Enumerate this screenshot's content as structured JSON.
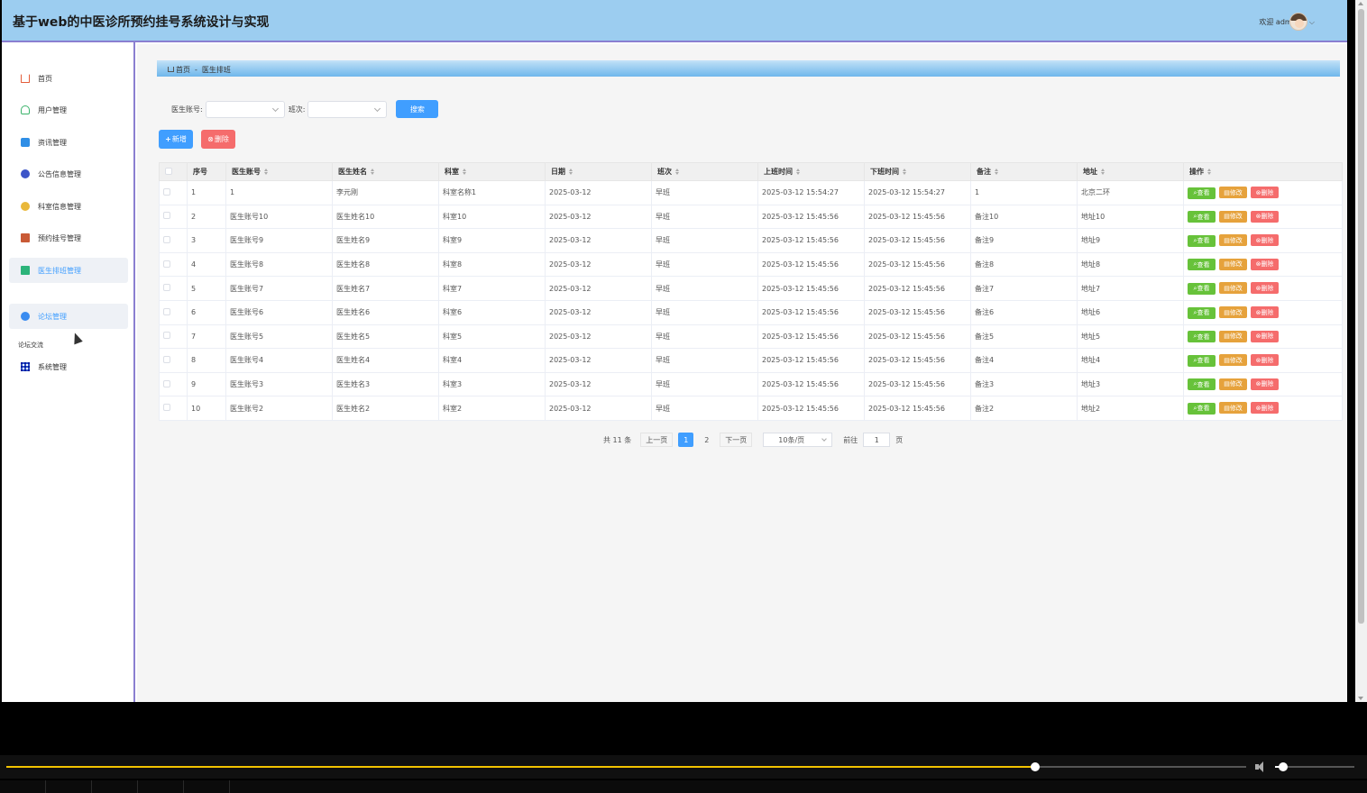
{
  "header": {
    "title": "基于web的中医诊所预约挂号系统设计与实现",
    "welcome": "欢迎 admin",
    "avatar_icon": "avatar-icon",
    "caret": "⌵"
  },
  "sidebar": {
    "items": [
      {
        "label": "首页",
        "icon": "home-icon"
      },
      {
        "label": "用户管理",
        "icon": "user-icon"
      },
      {
        "label": "资讯管理",
        "icon": "news-icon"
      },
      {
        "label": "公告信息管理",
        "icon": "notice-icon"
      },
      {
        "label": "科室信息管理",
        "icon": "department-icon"
      },
      {
        "label": "预约挂号管理",
        "icon": "appointment-icon"
      },
      {
        "label": "医生排班管理",
        "icon": "schedule-icon",
        "active": true
      },
      {
        "label": "论坛管理",
        "icon": "forum-icon"
      },
      {
        "label": "系统管理",
        "icon": "grid-icon"
      }
    ],
    "forum_note": "论坛交流"
  },
  "breadcrumb": {
    "home": "首页",
    "separator": "-",
    "current": "医生排班"
  },
  "search": {
    "account_label": "医生账号:",
    "shift_label": "班次:",
    "search_button": "搜索"
  },
  "actions": {
    "add": "新增",
    "delete": "删除"
  },
  "table": {
    "headers": [
      "序号",
      "医生账号",
      "医生姓名",
      "科室",
      "日期",
      "班次",
      "上班时间",
      "下班时间",
      "备注",
      "地址",
      "操作"
    ],
    "op_view": "查看",
    "op_edit": "修改",
    "op_delete": "删除",
    "rows": [
      [
        "1",
        "1",
        "李元刚",
        "科室名称1",
        "2025-03-12",
        "早班",
        "2025-03-12 15:54:27",
        "2025-03-12 15:54:27",
        "1",
        "北京二环"
      ],
      [
        "2",
        "医生账号10",
        "医生姓名10",
        "科室10",
        "2025-03-12",
        "早班",
        "2025-03-12 15:45:56",
        "2025-03-12 15:45:56",
        "备注10",
        "地址10"
      ],
      [
        "3",
        "医生账号9",
        "医生姓名9",
        "科室9",
        "2025-03-12",
        "早班",
        "2025-03-12 15:45:56",
        "2025-03-12 15:45:56",
        "备注9",
        "地址9"
      ],
      [
        "4",
        "医生账号8",
        "医生姓名8",
        "科室8",
        "2025-03-12",
        "早班",
        "2025-03-12 15:45:56",
        "2025-03-12 15:45:56",
        "备注8",
        "地址8"
      ],
      [
        "5",
        "医生账号7",
        "医生姓名7",
        "科室7",
        "2025-03-12",
        "早班",
        "2025-03-12 15:45:56",
        "2025-03-12 15:45:56",
        "备注7",
        "地址7"
      ],
      [
        "6",
        "医生账号6",
        "医生姓名6",
        "科室6",
        "2025-03-12",
        "早班",
        "2025-03-12 15:45:56",
        "2025-03-12 15:45:56",
        "备注6",
        "地址6"
      ],
      [
        "7",
        "医生账号5",
        "医生姓名5",
        "科室5",
        "2025-03-12",
        "早班",
        "2025-03-12 15:45:56",
        "2025-03-12 15:45:56",
        "备注5",
        "地址5"
      ],
      [
        "8",
        "医生账号4",
        "医生姓名4",
        "科室4",
        "2025-03-12",
        "早班",
        "2025-03-12 15:45:56",
        "2025-03-12 15:45:56",
        "备注4",
        "地址4"
      ],
      [
        "9",
        "医生账号3",
        "医生姓名3",
        "科室3",
        "2025-03-12",
        "早班",
        "2025-03-12 15:45:56",
        "2025-03-12 15:45:56",
        "备注3",
        "地址3"
      ],
      [
        "10",
        "医生账号2",
        "医生姓名2",
        "科室2",
        "2025-03-12",
        "早班",
        "2025-03-12 15:45:56",
        "2025-03-12 15:45:56",
        "备注2",
        "地址2"
      ]
    ]
  },
  "pagination": {
    "total": "共 11 条",
    "prev": "上一页",
    "pages": [
      "1",
      "2"
    ],
    "current_page": "1",
    "next": "下一页",
    "page_size": "10条/页",
    "goto_label": "前往",
    "goto_value": "1",
    "goto_unit": "页"
  },
  "player": {
    "progress_fraction": 0.83,
    "volume_fraction": 0.1
  },
  "colors": {
    "header_bg": "#9ccdf0",
    "accent": "#409eff",
    "danger": "#f56c6c",
    "success": "#67c23a",
    "warning": "#e6a23c"
  }
}
